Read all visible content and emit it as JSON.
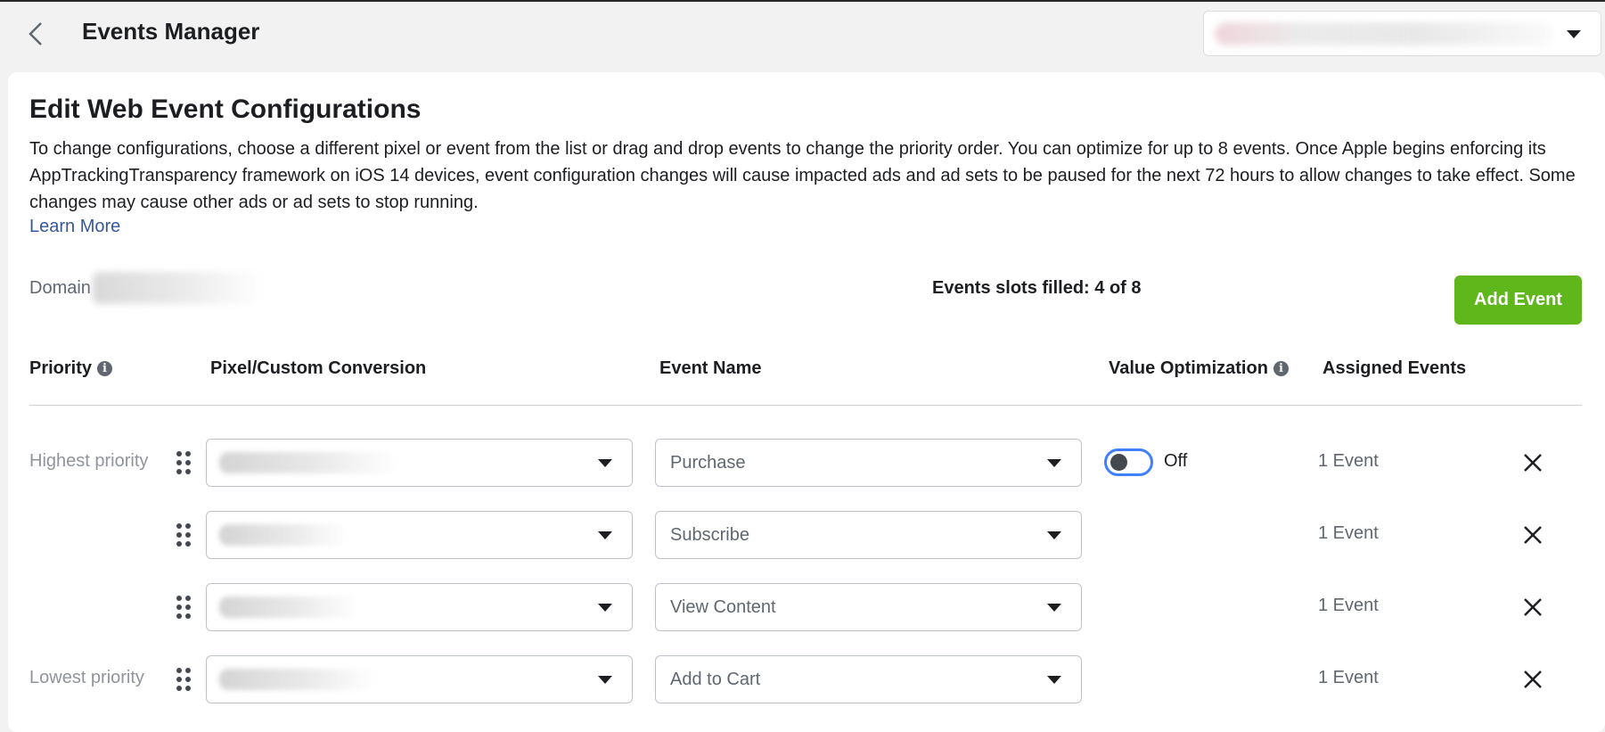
{
  "header": {
    "title": "Events Manager"
  },
  "card": {
    "title": "Edit Web Event Configurations",
    "description": "To change configurations, choose a different pixel or event from the list or drag and drop events to change the priority order. You can optimize for up to 8 events. Once Apple begins enforcing its AppTrackingTransparency framework on iOS 14 devices, event configuration changes will cause impacted ads and ad sets to be paused for the next 72 hours to allow changes to take effect. Some changes may cause other ads or ad sets to stop running.",
    "learn_more": "Learn More",
    "domain_label": "Domain",
    "slots_filled": "Events slots filled: 4 of 8",
    "add_event": "Add Event"
  },
  "table": {
    "headers": {
      "priority": "Priority",
      "pixel": "Pixel/Custom Conversion",
      "event_name": "Event Name",
      "value_optimization": "Value Optimization",
      "assigned_events": "Assigned Events"
    },
    "rows": [
      {
        "priority_label": "Highest priority",
        "event": "Purchase",
        "value_optimization": "Off",
        "assigned": "1 Event"
      },
      {
        "priority_label": "",
        "event": "Subscribe",
        "assigned": "1 Event"
      },
      {
        "priority_label": "",
        "event": "View Content",
        "assigned": "1 Event"
      },
      {
        "priority_label": "Lowest priority",
        "event": "Add to Cart",
        "assigned": "1 Event"
      }
    ]
  },
  "colors": {
    "accent_green": "#5fb71b",
    "link_blue": "#385898",
    "toggle_blue": "#4080ff"
  },
  "icons": {
    "back": "chevron-left-icon",
    "dropdown": "caret-down-icon",
    "info": "info-icon",
    "drag": "drag-handle-icon",
    "remove": "close-icon"
  }
}
